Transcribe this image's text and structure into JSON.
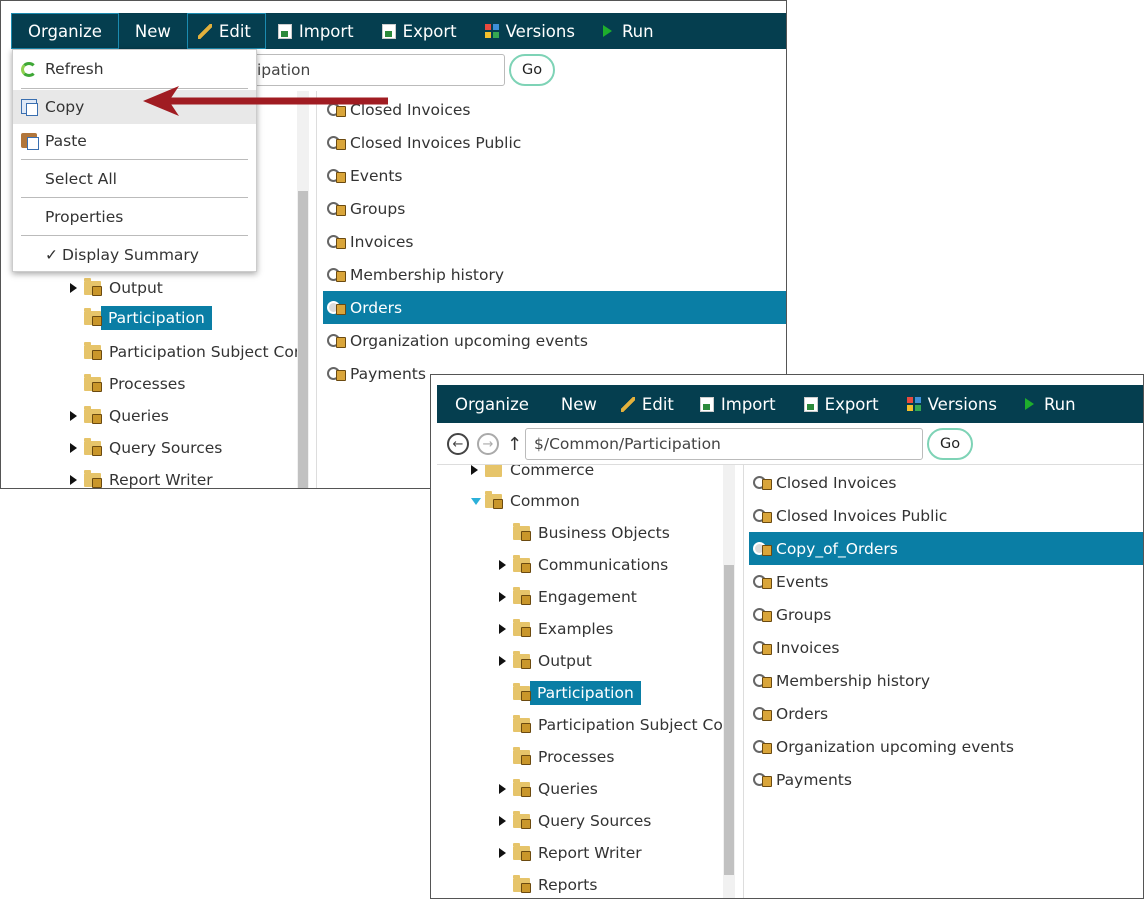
{
  "toolbar": {
    "organize": "Organize",
    "new": "New",
    "edit": "Edit",
    "import": "Import",
    "export": "Export",
    "versions": "Versions",
    "run": "Run"
  },
  "before": {
    "path_fragment": "ipation",
    "go": "Go",
    "organize_menu": {
      "refresh": "Refresh",
      "copy": "Copy",
      "paste": "Paste",
      "select_all": "Select All",
      "properties": "Properties",
      "display_summary": "Display Summary",
      "display_summary_check": "✓"
    },
    "tree": [
      "Output",
      "Participation",
      "Participation Subject Cor",
      "Processes",
      "Queries",
      "Query Sources",
      "Report Writer"
    ],
    "list": [
      "Closed Invoices",
      "Closed Invoices Public",
      "Events",
      "Groups",
      "Invoices",
      "Membership history",
      "Orders",
      "Organization upcoming events",
      "Payments"
    ],
    "selected_item": "Orders"
  },
  "after": {
    "path": "$/Common/Participation",
    "go": "Go",
    "tree": [
      "Commerce",
      "Common",
      "Business Objects",
      "Communications",
      "Engagement",
      "Examples",
      "Output",
      "Participation",
      "Participation Subject Cor",
      "Processes",
      "Queries",
      "Query Sources",
      "Report Writer",
      "Reports"
    ],
    "list": [
      "Closed Invoices",
      "Closed Invoices Public",
      "Copy_of_Orders",
      "Events",
      "Groups",
      "Invoices",
      "Membership history",
      "Orders",
      "Organization upcoming events",
      "Payments"
    ],
    "selected_item": "Copy_of_Orders"
  },
  "colors": {
    "toolbar": "#053e4f",
    "selection": "#0a7ea5",
    "arrow": "#a01c22",
    "go_border": "#7ed3b6"
  },
  "icons": [
    "pencil-icon",
    "import-icon",
    "export-icon",
    "versions-icon",
    "run-icon",
    "refresh-icon",
    "copy-icon",
    "paste-icon",
    "folder-lock-icon",
    "query-icon",
    "back-icon",
    "forward-icon",
    "up-icon"
  ]
}
